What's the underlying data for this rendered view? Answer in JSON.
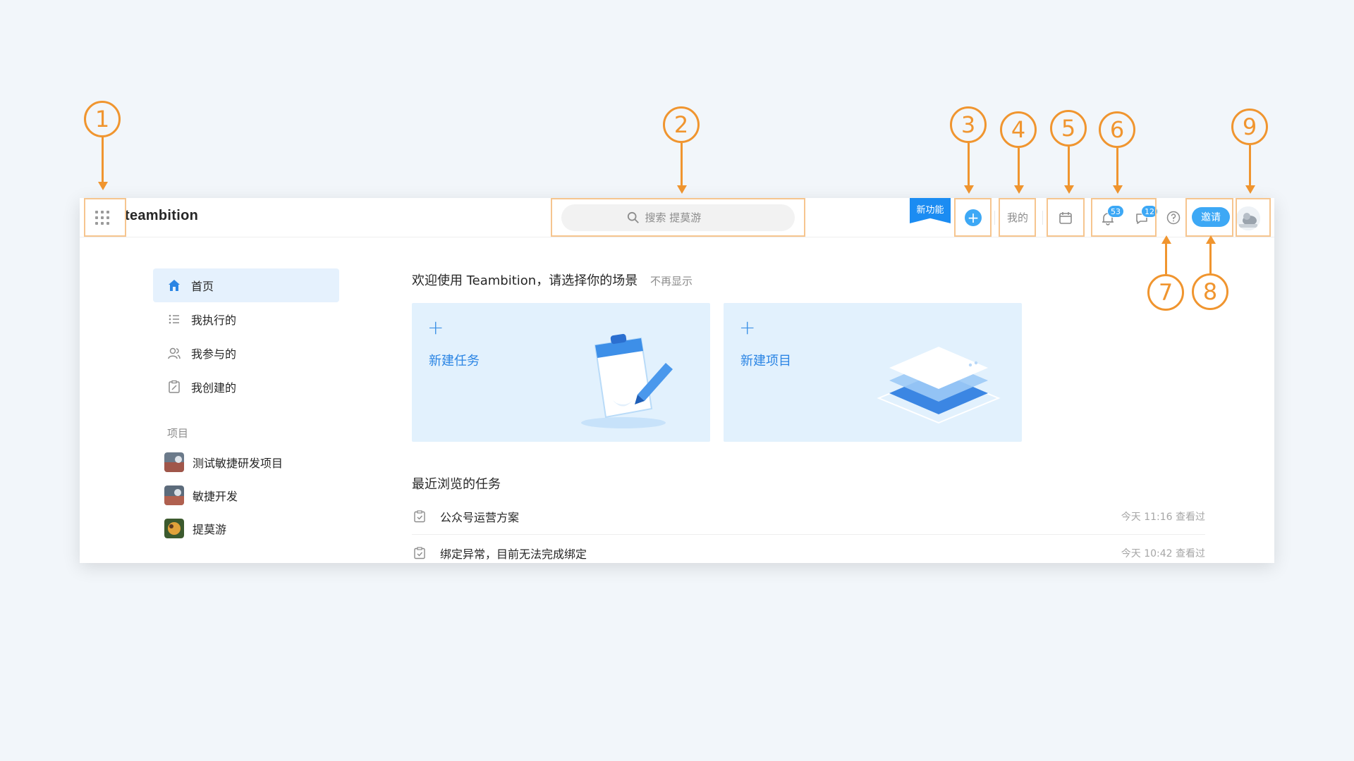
{
  "app": {
    "logo": "teambition"
  },
  "header": {
    "search_placeholder": "搜索 提莫游",
    "new_feature_label": "新功能",
    "mine_label": "我的",
    "notifications_count": "53",
    "messages_count": "12",
    "invite_label": "邀请"
  },
  "sidebar": {
    "items": [
      {
        "label": "首页",
        "icon": "home-icon"
      },
      {
        "label": "我执行的",
        "icon": "list-icon"
      },
      {
        "label": "我参与的",
        "icon": "people-icon"
      },
      {
        "label": "我创建的",
        "icon": "clipboard-edit-icon"
      }
    ],
    "projects_label": "项目",
    "projects": [
      {
        "label": "测试敏捷研发项目"
      },
      {
        "label": "敏捷开发"
      },
      {
        "label": "提莫游"
      }
    ]
  },
  "main": {
    "welcome_title": "欢迎使用 Teambition，请选择你的场景",
    "dismiss_label": "不再显示",
    "cards": [
      {
        "plus": "+",
        "label": "新建任务"
      },
      {
        "plus": "+",
        "label": "新建项目"
      }
    ],
    "recent_title": "最近浏览的任务",
    "recent_tasks": [
      {
        "name": "公众号运营方案",
        "time": "今天 11:16 查看过"
      },
      {
        "name": "绑定异常，目前无法完成绑定",
        "time": "今天 10:42 查看过"
      }
    ]
  },
  "annotations": [
    "1",
    "2",
    "3",
    "4",
    "5",
    "6",
    "7",
    "8",
    "9"
  ],
  "colors": {
    "accent": "#3da8f5",
    "annotation": "#f0952f",
    "card_bg": "#e2f1fd"
  }
}
